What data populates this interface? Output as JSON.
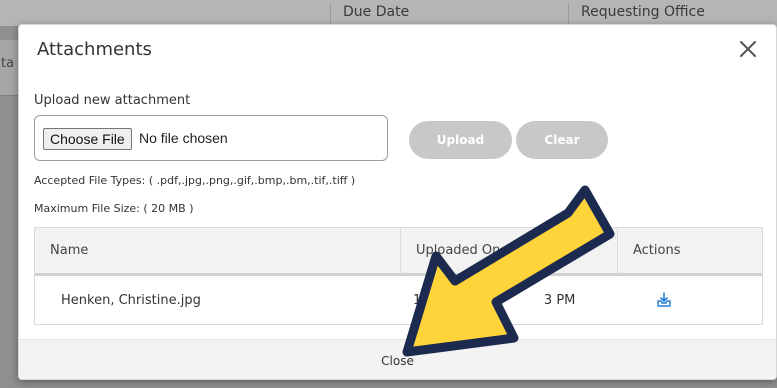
{
  "background": {
    "columns": [
      "Due Date",
      "Requesting Office"
    ],
    "left_fragment": "ta"
  },
  "modal": {
    "title": "Attachments",
    "close_icon": "close-x-icon",
    "upload_label": "Upload new attachment",
    "file_input": {
      "button_label": "Choose File",
      "status": "No file chosen"
    },
    "buttons": {
      "upload": "Upload",
      "clear": "Clear"
    },
    "accepted_types": "Accepted File Types: ( .pdf,.jpg,.png,.gif,.bmp,.bm,.tif,.tiff )",
    "max_size": "Maximum File Size: ( 20 MB )",
    "table": {
      "headers": {
        "name": "Name",
        "uploaded_on": "Uploaded On",
        "actions": "Actions"
      },
      "rows": [
        {
          "name": "Henken, Christine.jpg",
          "uploaded_on": "12/",
          "uploaded_on_tail": "3 PM",
          "action_icon": "download-icon"
        }
      ]
    },
    "footer_close": "Close"
  },
  "colors": {
    "arrow_fill": "#ffd43b",
    "arrow_stroke": "#1b2a4e",
    "action_icon": "#1d7fd6",
    "pill_disabled": "#c8c8c8"
  }
}
